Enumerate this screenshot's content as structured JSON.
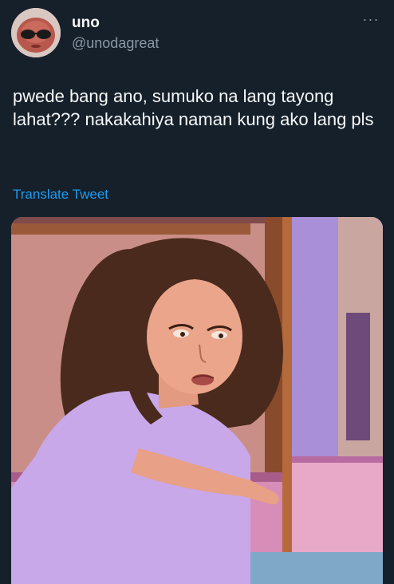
{
  "user": {
    "display_name": "uno",
    "handle": "@unodagreat",
    "avatar_icon": "avatar-image"
  },
  "menu": {
    "more_glyph": "···",
    "icon": "more-options-icon"
  },
  "tweet": {
    "text": "pwede bang ano, sumuko na lang tayong lahat??? nakakahiya naman kung ako lang pls"
  },
  "actions": {
    "translate_label": "Translate Tweet"
  },
  "colors": {
    "background": "#15202b",
    "primary_text": "#f7f9f9",
    "secondary_text": "#8b98a5",
    "accent": "#1d9bf0"
  }
}
